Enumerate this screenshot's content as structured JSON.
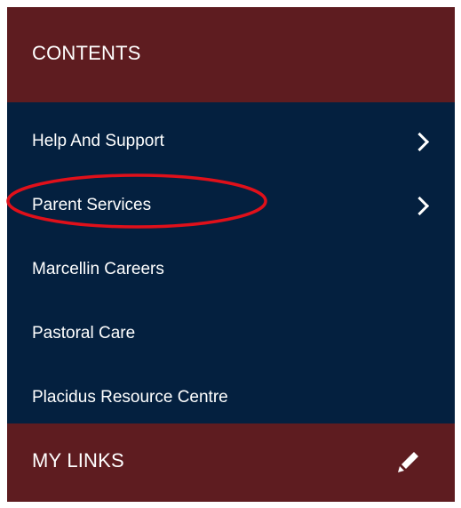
{
  "contents_header": {
    "title": "CONTENTS"
  },
  "menu": {
    "items": [
      {
        "label": "Help And Support",
        "has_submenu": true
      },
      {
        "label": "Parent Services",
        "has_submenu": true
      },
      {
        "label": "Marcellin Careers",
        "has_submenu": false
      },
      {
        "label": "Pastoral Care",
        "has_submenu": false
      },
      {
        "label": "Placidus Resource Centre",
        "has_submenu": false
      }
    ]
  },
  "my_links_header": {
    "title": "MY LINKS",
    "action_icon": "pencil-icon"
  },
  "annotation": {
    "shape": "ellipse",
    "color": "#e0101a",
    "target": "Parent Services"
  },
  "colors": {
    "header_background": "#5e1c20",
    "menu_background": "#04203f",
    "text": "#ffffff"
  }
}
